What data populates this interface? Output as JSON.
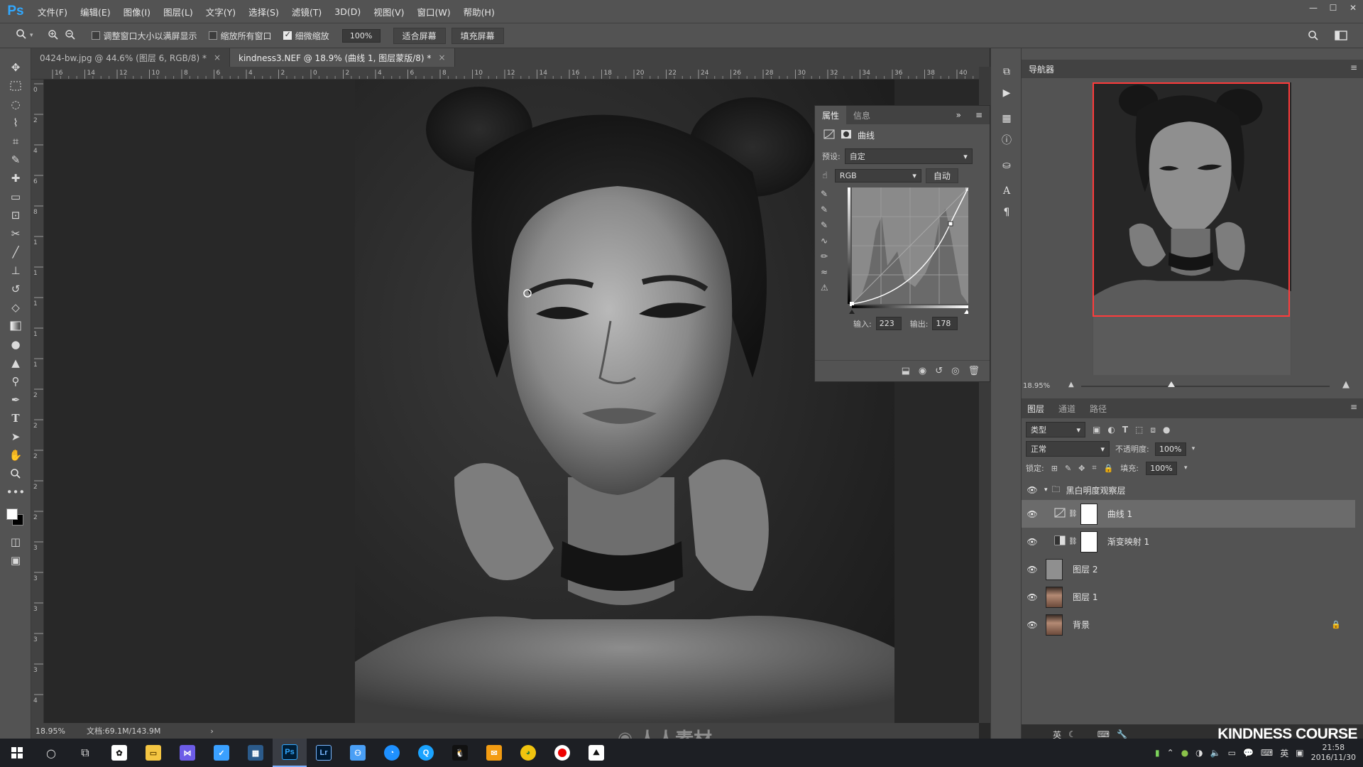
{
  "menubar": {
    "app_logo": "Ps",
    "items": [
      "文件(F)",
      "编辑(E)",
      "图像(I)",
      "图层(L)",
      "文字(Y)",
      "选择(S)",
      "滤镜(T)",
      "3D(D)",
      "视图(V)",
      "窗口(W)",
      "帮助(H)"
    ]
  },
  "options": {
    "resize_windows": "调整窗口大小以满屏显示",
    "zoom_all": "缩放所有窗口",
    "scrubby_zoom": "细微缩放",
    "zoom_value": "100%",
    "fit_screen": "适合屏幕",
    "fill_screen": "填充屏幕"
  },
  "tabs": [
    {
      "label": "0424-bw.jpg @ 44.6% (图层 6, RGB/8) *",
      "close": "×"
    },
    {
      "label": "kindness3.NEF @ 18.9% (曲线 1, 图层蒙版/8) *",
      "close": "×"
    }
  ],
  "ruler_top": [
    "16",
    "14",
    "12",
    "10",
    "8",
    "6",
    "4",
    "2",
    "0",
    "2",
    "4",
    "6",
    "8",
    "10",
    "12",
    "14",
    "16",
    "18",
    "20",
    "22",
    "24",
    "26",
    "28",
    "30",
    "32",
    "34",
    "36",
    "38",
    "40"
  ],
  "ruler_left": [
    "0",
    "2",
    "4",
    "6",
    "8",
    "1",
    "1",
    "1",
    "1",
    "1",
    "2",
    "2",
    "2",
    "2",
    "2",
    "3",
    "3",
    "3",
    "3",
    "3",
    "4"
  ],
  "status": {
    "zoom": "18.95%",
    "doc": "文档:69.1M/143.9M"
  },
  "properties": {
    "tab_properties": "属性",
    "tab_info": "信息",
    "curve_title": "曲线",
    "preset_label": "预设:",
    "preset_value": "自定",
    "channel_value": "RGB",
    "auto": "自动",
    "input_label": "输入:",
    "input_value": "223",
    "output_label": "输出:",
    "output_value": "178"
  },
  "navigator": {
    "title": "导航器",
    "zoom": "18.95%"
  },
  "layers_panel": {
    "tab_layers": "图层",
    "tab_channels": "通道",
    "tab_paths": "路径",
    "filter_kind": "类型",
    "blend_mode": "正常",
    "opacity_label": "不透明度:",
    "opacity_value": "100%",
    "lock_label": "锁定:",
    "fill_label": "填充:",
    "fill_value": "100%",
    "layers": [
      {
        "name": "黑白明度观察层",
        "type": "group"
      },
      {
        "name": "曲线 1",
        "type": "curves"
      },
      {
        "name": "渐变映射 1",
        "type": "gradient"
      },
      {
        "name": "图层 2",
        "type": "gray"
      },
      {
        "name": "图层 1",
        "type": "photo"
      },
      {
        "name": "背景",
        "type": "photo-locked"
      }
    ]
  },
  "watermarks": {
    "center": "人人素材",
    "course": "KINDNESS COURSE"
  },
  "taskbar": {
    "ime": "英",
    "time": "21:58",
    "date": "2016/11/30"
  },
  "colors": {
    "ps_blue": "#31a8ff",
    "nav_frame": "#ff3b3b",
    "panel_bg": "#535353"
  }
}
